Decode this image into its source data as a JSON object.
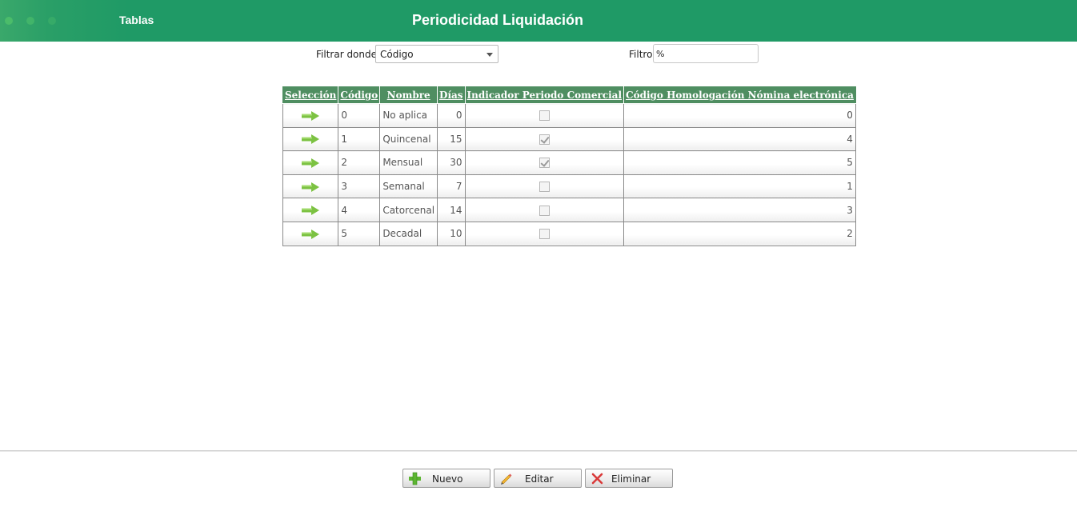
{
  "header": {
    "app_title": "Tablas",
    "page_title": "Periodicidad Liquidación",
    "background_color": "#1f9a66"
  },
  "filters": {
    "filter_where_label": "Filtrar donde",
    "filter_where_value": "Código",
    "filter_label": "Filtro",
    "filter_value": "%"
  },
  "table": {
    "header_color": "#4f8e61",
    "columns": [
      "Selección",
      "Código",
      "Nombre",
      "Días",
      "Indicador Periodo Comercial",
      "Código Homologación Nómina electrónica"
    ],
    "rows": [
      {
        "codigo": "0",
        "nombre": "No aplica",
        "dias": "0",
        "comercial": false,
        "homologacion": "0"
      },
      {
        "codigo": "1",
        "nombre": "Quincenal",
        "dias": "15",
        "comercial": true,
        "homologacion": "4"
      },
      {
        "codigo": "2",
        "nombre": "Mensual",
        "dias": "30",
        "comercial": true,
        "homologacion": "5"
      },
      {
        "codigo": "3",
        "nombre": "Semanal",
        "dias": "7",
        "comercial": false,
        "homologacion": "1"
      },
      {
        "codigo": "4",
        "nombre": "Catorcenal",
        "dias": "14",
        "comercial": false,
        "homologacion": "3"
      },
      {
        "codigo": "5",
        "nombre": "Decadal",
        "dias": "10",
        "comercial": false,
        "homologacion": "2"
      }
    ],
    "selection_icon": "arrow-right-icon"
  },
  "actions": {
    "new_label": "Nuevo",
    "edit_label": "Editar",
    "delete_label": "Eliminar",
    "new_icon": "plus-icon",
    "edit_icon": "pencil-icon",
    "delete_icon": "x-icon"
  }
}
